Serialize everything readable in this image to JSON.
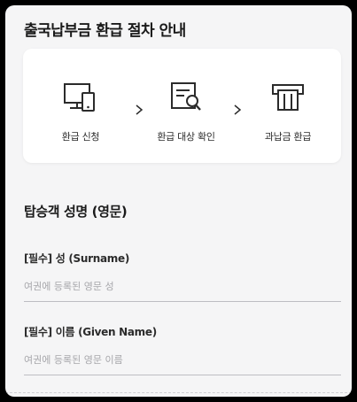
{
  "page": {
    "title": "출국납부금 환급 절차 안내"
  },
  "steps": [
    {
      "label": "환급 신청",
      "icon": "computer-phone-icon"
    },
    {
      "label": "환급 대상 확인",
      "icon": "document-search-icon"
    },
    {
      "label": "과납금 환급",
      "icon": "atm-icon"
    }
  ],
  "form": {
    "section_title": "탑승객 성명 (영문)",
    "surname": {
      "label": "[필수] 성 (Surname)",
      "placeholder": "여권에 등록된 영문 성",
      "value": ""
    },
    "given_name": {
      "label": "[필수] 이름 (Given Name)",
      "placeholder": "여권에 등록된 영문 이름",
      "value": ""
    }
  },
  "colors": {
    "background": "#f5f5f6",
    "card": "#ffffff",
    "text": "#1a1a1a",
    "placeholder": "#a7a7ab"
  }
}
